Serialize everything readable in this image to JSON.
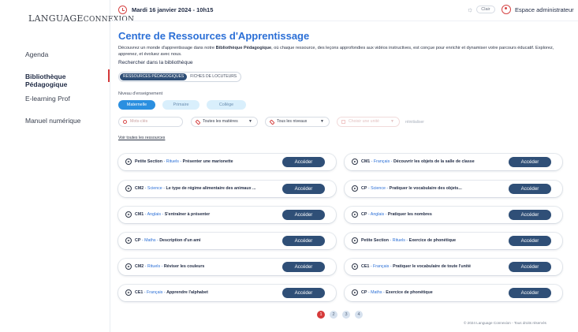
{
  "sidebar": {
    "logo_main": "LANGUAGE",
    "logo_second": "CONNEXION",
    "items": [
      {
        "label": "Agenda"
      },
      {
        "label": "Bibliothèque Pédagogique"
      },
      {
        "label": "E-learning Prof"
      },
      {
        "label": "Manuel numérique"
      }
    ],
    "active_color": "#d63a3a"
  },
  "topbar": {
    "date": "Mardi 16 janvier 2024 - 10h15",
    "theme_label": "Clair",
    "admin_label": "Espace administrateur",
    "accent": "#d64545"
  },
  "main": {
    "title": "Centre de Ressources d'Apprentissage",
    "intro_part1": "Découvrez un monde d'apprentissage dans notre ",
    "intro_bold": "Bibliothèque Pédagogique",
    "intro_part2": ", où chaque ressource, des leçons approfondies aux vidéos instructives, est conçue pour enrichir et dynamiser votre parcours éducatif. Explorez, apprenez, et évoluez avec nous.",
    "search_label": "Rechercher dans la bibliothèque",
    "segments": [
      "RESSOURCES PÉDAGOGIQUES",
      "FICHES DE LOCUTEURS"
    ],
    "level_label": "Niveau d'enseignement",
    "levels": [
      "Maternelle",
      "Primaire",
      "Collège"
    ],
    "filters": {
      "search_placeholder": "Mots-clés",
      "subjects": "Toutes les matières",
      "levels": "Tous les niveaux",
      "disabled": "Choisir une unité",
      "reset": "réinitialiser"
    },
    "see_all": "Voir toutes les ressources",
    "button_label": "Accéder",
    "resources": [
      {
        "level": "Petite Section",
        "subject": "Rituels",
        "title": "Présenter une marionette"
      },
      {
        "level": "CM1",
        "subject": "Français",
        "title": "Découvrir les objets de la salle de classe"
      },
      {
        "level": "CM2",
        "subject": "Science",
        "title": "Le type de régime alimentaire des animaux ..."
      },
      {
        "level": "CP",
        "subject": "Science",
        "title": "Pratiquer le vocabulaire des objets..."
      },
      {
        "level": "CM1",
        "subject": "Anglais",
        "title": "S'entraîner à présenter"
      },
      {
        "level": "CP",
        "subject": "Anglais",
        "title": "Pratiquer les nombres"
      },
      {
        "level": "CP",
        "subject": "Maths",
        "title": "Description d'un ami"
      },
      {
        "level": "Petite Section",
        "subject": "Rituels",
        "title": "Exercice de phonétique"
      },
      {
        "level": "CM2",
        "subject": "Rituels",
        "title": "Réviser les couleurs"
      },
      {
        "level": "CE1",
        "subject": "Français",
        "title": "Pratiquer le vocabulaire de toute l'unité"
      },
      {
        "level": "CE1",
        "subject": "Français",
        "title": "Apprendre l'alphabet"
      },
      {
        "level": "CP",
        "subject": "Maths",
        "title": "Exercice de phonétique"
      }
    ],
    "pages": [
      "1",
      "2",
      "3",
      "4"
    ],
    "current_page": "1",
    "footer": "© 2024 Language Connexion - Tous droits réservés"
  }
}
